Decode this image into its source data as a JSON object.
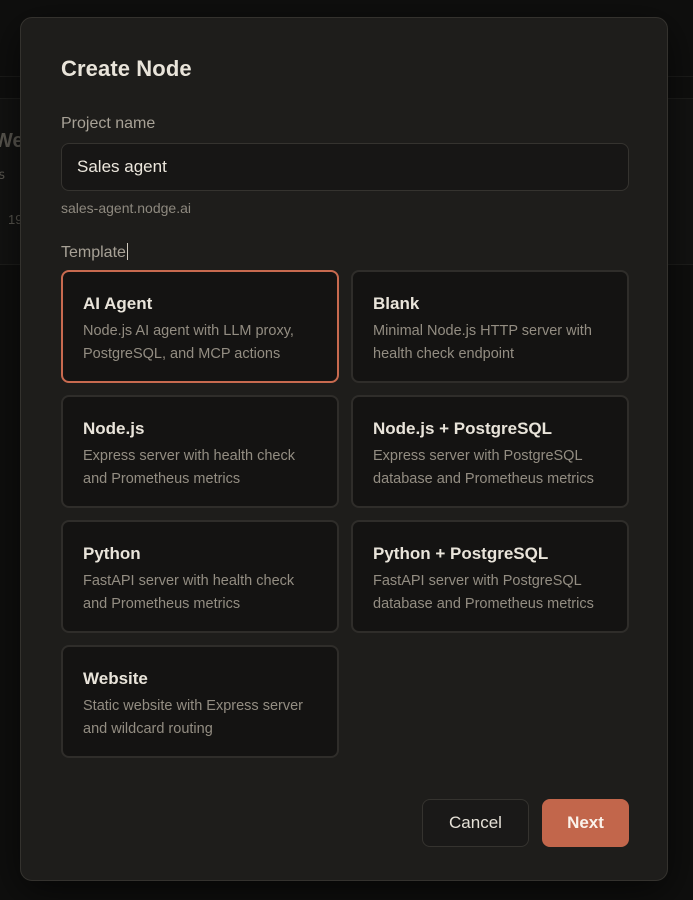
{
  "background": {
    "title_fragment": "Web",
    "sub_fragment": "bs",
    "num_fragment": "19"
  },
  "modal": {
    "title": "Create Node",
    "project_name_label": "Project name",
    "project_name_value": "Sales agent",
    "subdomain": "sales-agent.nodge.ai",
    "template_label": "Template",
    "templates": [
      {
        "name": "AI Agent",
        "desc": "Node.js AI agent with LLM proxy, PostgreSQL, and MCP actions",
        "selected": true
      },
      {
        "name": "Blank",
        "desc": "Minimal Node.js HTTP server with health check endpoint",
        "selected": false
      },
      {
        "name": "Node.js",
        "desc": "Express server with health check and Prometheus metrics",
        "selected": false
      },
      {
        "name": "Node.js + PostgreSQL",
        "desc": "Express server with PostgreSQL database and Prometheus metrics",
        "selected": false
      },
      {
        "name": "Python",
        "desc": "FastAPI server with health check and Prometheus metrics",
        "selected": false
      },
      {
        "name": "Python + PostgreSQL",
        "desc": "FastAPI server with PostgreSQL database and Prometheus metrics",
        "selected": false
      },
      {
        "name": "Website",
        "desc": "Static website with Express server and wildcard routing",
        "selected": false
      }
    ],
    "cancel_label": "Cancel",
    "next_label": "Next"
  },
  "colors": {
    "accent": "#c2664b",
    "selected_border": "#c86a4f",
    "modal_bg": "#1e1d1b"
  }
}
